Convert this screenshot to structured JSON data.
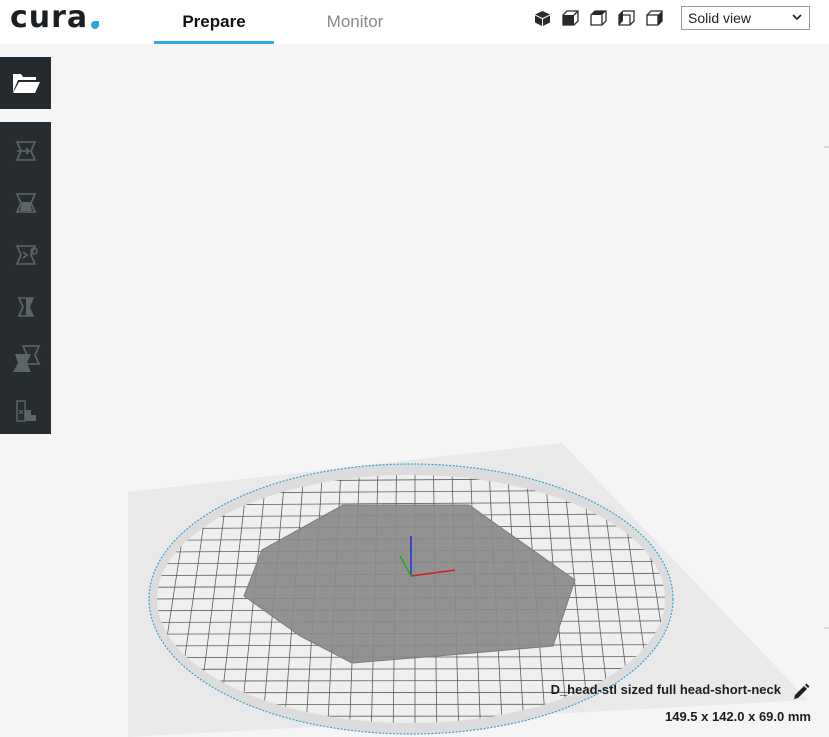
{
  "app": {
    "logo_text": "cura",
    "accent_color": "#30a8e0"
  },
  "header": {
    "tabs": [
      {
        "label": "Prepare",
        "active": true
      },
      {
        "label": "Monitor",
        "active": false
      }
    ],
    "view_buttons": [
      "3d-view-icon",
      "front-view-icon",
      "top-view-icon",
      "left-view-icon",
      "right-view-icon"
    ],
    "view_mode": {
      "selected": "Solid view"
    }
  },
  "toolbar": {
    "open_file_icon": "folder-open-icon",
    "tools": [
      "move-tool-icon",
      "scale-tool-icon",
      "rotate-tool-icon",
      "mirror-tool-icon",
      "per-model-settings-icon",
      "support-blocker-icon"
    ]
  },
  "object": {
    "name": "D_head-stl sized full head-short-neck",
    "dimensions": "149.5 x 142.0 x 69.0 mm"
  }
}
